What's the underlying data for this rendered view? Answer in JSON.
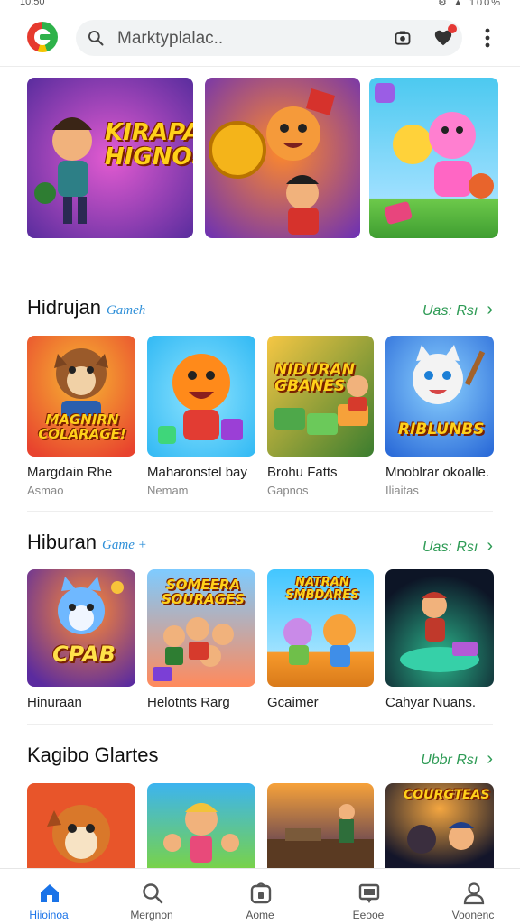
{
  "status": {
    "time": "10:50",
    "icons_text": "⚙ ▲ 100%"
  },
  "search": {
    "placeholder": "Marktyplalac.."
  },
  "banners": [
    {
      "title": "KIRAPAIR HIGNOS",
      "colors": [
        "#5a2d9e",
        "#e35bd1"
      ]
    },
    {
      "title": "",
      "colors": [
        "#6a2fb6",
        "#ff8a2a"
      ]
    },
    {
      "title": "",
      "colors": [
        "#4cc9f0",
        "#ff66c4"
      ]
    }
  ],
  "sections": [
    {
      "title": "Hidrujan",
      "subtitle": "Gameh",
      "more_label": "Uasː Rsı",
      "apps": [
        {
          "name": "Margdain Rhe",
          "sub": "Asmao",
          "tile_text": "MAGNIRN COLARAGE!",
          "colors": [
            "#f7b733",
            "#e8432e"
          ]
        },
        {
          "name": "Maharonstel bay",
          "sub": "Nemam",
          "tile_text": "",
          "colors": [
            "#2bb6f3",
            "#ff7a1a"
          ]
        },
        {
          "name": "Brohu Fatts",
          "sub": "Gapnos",
          "tile_text": "NIDURAN GBANES",
          "colors": [
            "#3b7d2f",
            "#f6c744"
          ]
        },
        {
          "name": "Mnoblrar okoalle.",
          "sub": "Iliaitas",
          "tile_text": "RIBLUNBS",
          "colors": [
            "#2a6ad8",
            "#8dd3ff"
          ]
        }
      ]
    },
    {
      "title": "Hiburan",
      "subtitle": "Game +",
      "more_label": "Uasː Rsı",
      "apps": [
        {
          "name": "Hinuraan",
          "sub": "",
          "tile_text": "CPAB",
          "colors": [
            "#5b2b9f",
            "#ff8a33"
          ]
        },
        {
          "name": "Helotnts Rarg",
          "sub": "",
          "tile_text": "SOMEERA SOURAGES",
          "colors": [
            "#7ecbff",
            "#ff5a3c"
          ]
        },
        {
          "name": "Gcaimer",
          "sub": "",
          "tile_text": "NATRAN SMBDARES",
          "colors": [
            "#42c6ff",
            "#f79a2b"
          ]
        },
        {
          "name": "Cahyar Nuans.",
          "sub": "",
          "tile_text": "",
          "colors": [
            "#0d1526",
            "#2bb58b"
          ]
        }
      ]
    },
    {
      "title": "Kagibo Glartes",
      "subtitle": "",
      "more_label": "Ubbr Rsı",
      "apps": [
        {
          "name": "",
          "sub": "",
          "tile_text": "",
          "colors": [
            "#e8552a",
            "#7d2bb0"
          ]
        },
        {
          "name": "",
          "sub": "",
          "tile_text": "",
          "colors": [
            "#3cb4f0",
            "#78d24a"
          ]
        },
        {
          "name": "",
          "sub": "",
          "tile_text": "",
          "colors": [
            "#f7a23a",
            "#3c2a5a"
          ]
        },
        {
          "name": "",
          "sub": "",
          "tile_text": "COURGTEAS",
          "colors": [
            "#13152a",
            "#f4a640"
          ]
        }
      ]
    }
  ],
  "nav": [
    {
      "label": "Hiioinoa",
      "icon": "home-icon",
      "active": true
    },
    {
      "label": "Mergnon",
      "icon": "search-icon",
      "active": false
    },
    {
      "label": "Aome",
      "icon": "apps-icon",
      "active": false
    },
    {
      "label": "Eeooe",
      "icon": "chat-icon",
      "active": false
    },
    {
      "label": "Voonenc",
      "icon": "profile-icon",
      "active": false
    }
  ],
  "colors": {
    "accent": "#1a73e8",
    "more_link": "#2e9b55",
    "sub_link": "#2e8fd8",
    "badge": "#e53935"
  }
}
